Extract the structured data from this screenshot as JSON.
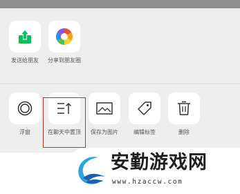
{
  "share_row": [
    {
      "id": "send",
      "label": "发送给朋友",
      "icon": "share-up-arrow-icon"
    },
    {
      "id": "moments",
      "label": "分享到朋友圈",
      "icon": "moments-aperture-icon"
    }
  ],
  "action_row": [
    {
      "id": "float",
      "label": "浮窗",
      "icon": "float-window-circle-icon"
    },
    {
      "id": "pin",
      "label": "在聊天中置顶",
      "icon": "pin-to-top-icon"
    },
    {
      "id": "save-image",
      "label": "保存为图片",
      "icon": "image-icon"
    },
    {
      "id": "edit-tag",
      "label": "编辑标签",
      "icon": "tag-icon"
    },
    {
      "id": "delete",
      "label": "删除",
      "icon": "trash-icon"
    }
  ],
  "watermark": {
    "title": "安勤游戏网",
    "url": "www.hzaccw.com"
  },
  "colors": {
    "share_green": "#07c160",
    "highlight_red": "#c8322c",
    "icon_dark": "#333333"
  }
}
